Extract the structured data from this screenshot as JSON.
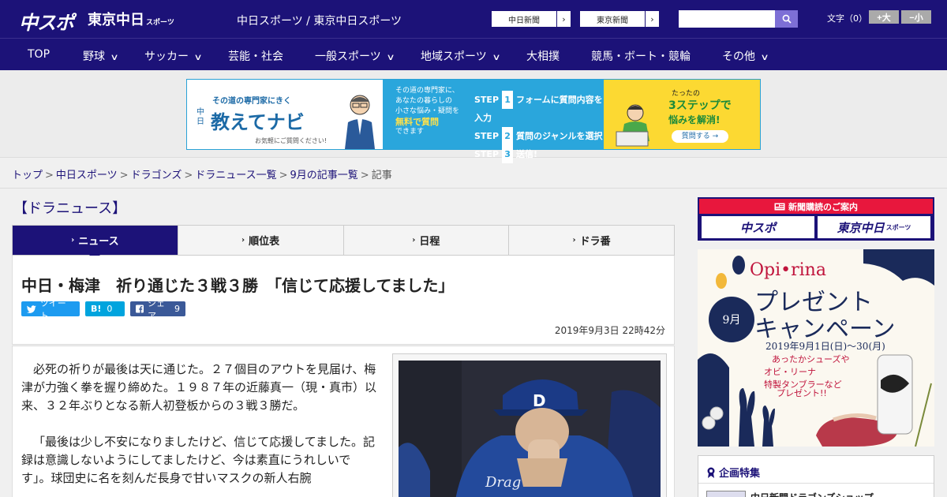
{
  "header": {
    "logo_main": "中スポ",
    "logo_sub": "東京中日",
    "logo_sub_small": "スポーツ",
    "site_title": "中日スポーツ / 東京中日スポーツ",
    "links": [
      {
        "label": "中日新聞",
        "arrow": "›"
      },
      {
        "label": "東京新聞",
        "arrow": "›"
      }
    ],
    "search_placeholder": "",
    "fontsize_label": "文字（0）",
    "fontsize_plus": "+大",
    "fontsize_minus": "−小"
  },
  "nav": {
    "items": [
      {
        "label": "TOP",
        "chev": ""
      },
      {
        "label": "野球",
        "chev": "∨"
      },
      {
        "label": "サッカー",
        "chev": "∨"
      },
      {
        "label": "芸能・社会",
        "chev": ""
      },
      {
        "label": "一般スポーツ",
        "chev": "∨"
      },
      {
        "label": "地域スポーツ",
        "chev": "∨"
      },
      {
        "label": "大相撲",
        "chev": ""
      },
      {
        "label": "競馬・ボート・競輪",
        "chev": ""
      },
      {
        "label": "その他",
        "chev": "∨"
      }
    ]
  },
  "banner": {
    "small": "その道の専門家にきく",
    "big": "教えてナビ",
    "chu": "中日",
    "note": "お気軽にご質問ください!",
    "lead_lines": [
      "その道の専門家に、",
      "あなたの暮らしの",
      "小さな悩み・疑問を"
    ],
    "lead_highlight": "無料で質問",
    "lead_end": "できます",
    "steps": [
      {
        "step": "STEP",
        "num": "1",
        "text": "フォームに質問内容を入力"
      },
      {
        "step": "STEP",
        "num": "2",
        "text": "質問のジャンルを選択"
      },
      {
        "step": "STEP",
        "num": "3",
        "text": "送信!"
      }
    ],
    "right_t1": "たったの",
    "right_t2": "3ステップで",
    "right_t3": "悩みを解消!",
    "right_btn": "質問する →"
  },
  "breadcrumb": {
    "items": [
      "トップ",
      "中日スポーツ",
      "ドラゴンズ",
      "ドラニュース一覧",
      "9月の記事一覧"
    ],
    "current": "記事",
    "sep": ">"
  },
  "main": {
    "section_title": "【ドラニュース】",
    "tabs": [
      {
        "label": "ニュース",
        "chev": "›"
      },
      {
        "label": "順位表",
        "chev": "›"
      },
      {
        "label": "日程",
        "chev": "›"
      },
      {
        "label": "ドラ番",
        "chev": "›"
      }
    ],
    "headline": "中日・梅津　祈り通じた３戦３勝　「信じて応援してました」",
    "share": {
      "tweet": "ツイート",
      "hatena_label": "B!",
      "hatena_count": "0",
      "fb_label": "シェア",
      "fb_count": "9"
    },
    "date": "2019年9月3日 22時42分",
    "paragraphs": [
      "必死の祈りが最後は天に通じた。２７個目のアウトを見届け、梅津が力強く拳を握り締めた。１９８７年の近藤真一（現・真市）以来、３２年ぶりとなる新人初登板からの３戦３勝だ。",
      "「最後は少し不安になりましたけど、信じて応援してました。記録は意識しないようにしてましたけど、今は素直にうれしいです」。球団史に名を刻んだ長身で甘いマスクの新人右腕"
    ]
  },
  "sidebar": {
    "sub_title": "新聞購読のご案内",
    "sub_logo1": "中スポ",
    "sub_logo2": "東京中日",
    "sub_logo2_small": "スポーツ",
    "campaign": {
      "brand": "Opi•rina",
      "title1": "プレゼント",
      "title2": "キャンペーン",
      "month": "9月",
      "date": "2019年9月1日(日)〜30(月)",
      "desc1": "あったかシューズや",
      "desc2": "オビ・リーナ",
      "desc3": "特製タンブラーなど",
      "desc4": "プレゼント!!"
    },
    "kikaku_title": "企画特集",
    "kikaku_item": "中日新聞ドラゴンズショップ"
  }
}
